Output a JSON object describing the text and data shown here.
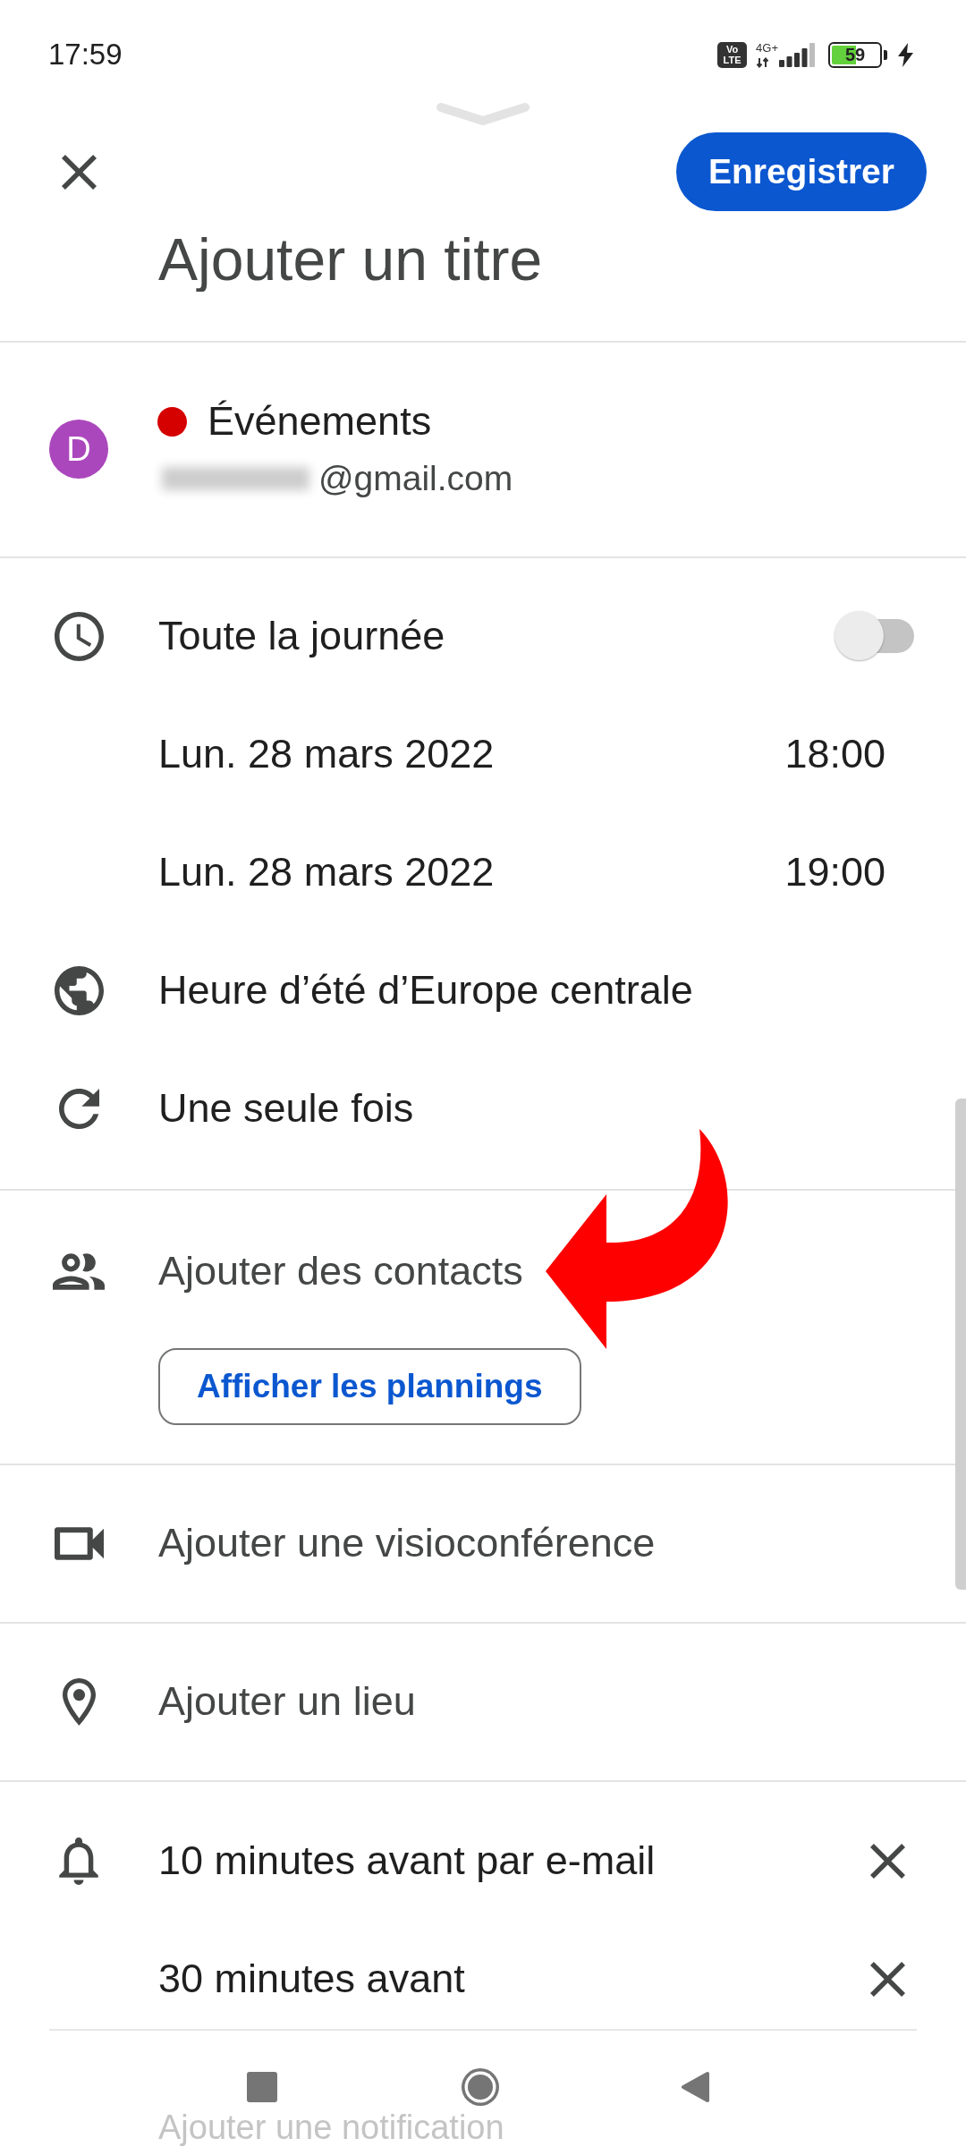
{
  "status_bar": {
    "time": "17:59",
    "volte": "Vo LTE",
    "network": "4G+",
    "battery": "59"
  },
  "header": {
    "save_button": "Enregistrer",
    "title": {
      "placeholder": "Ajouter un titre"
    }
  },
  "calendar": {
    "avatar": "D",
    "name": "Événements",
    "email": "@gmail.com"
  },
  "time": {
    "all_day": {
      "label": "Toute la journée",
      "on": false
    },
    "start": {
      "date": "Lun. 28 mars 2022",
      "time": "18:00"
    },
    "end": {
      "date": "Lun. 28 mars 2022",
      "time": "19:00"
    },
    "timezone": "Heure d’été d’Europe centrale",
    "recurrence": "Une seule fois"
  },
  "guests": {
    "label": "Ajouter des contacts",
    "schedules_button": "Afficher les plannings"
  },
  "conference": {
    "label": "Ajouter une visioconférence"
  },
  "location": {
    "label": "Ajouter un lieu"
  },
  "notifications": {
    "items": [
      {
        "label": "10 minutes avant par e-mail"
      },
      {
        "label": "30 minutes avant"
      }
    ],
    "add": "Ajouter une notification"
  }
}
